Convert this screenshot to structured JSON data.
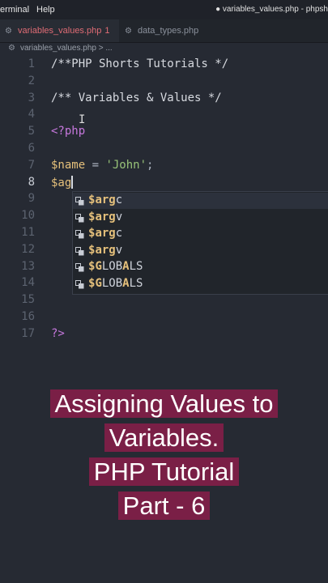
{
  "menubar": {
    "items": [
      "erminal",
      "Help"
    ],
    "title": "● variables_values.php - phpsh"
  },
  "tabs": [
    {
      "label": "variables_values.php",
      "modified": "1",
      "active": true,
      "icon": "php-file-icon"
    },
    {
      "label": "data_types.php",
      "active": false,
      "icon": "php-file-icon"
    }
  ],
  "breadcrumb": "variables_values.php > ...",
  "editor": {
    "lines": [
      {
        "n": "1",
        "parts": [
          {
            "t": "/**PHP Shorts Tutorials */",
            "c": "c-com"
          }
        ]
      },
      {
        "n": "2",
        "parts": []
      },
      {
        "n": "3",
        "parts": [
          {
            "t": "/** Variables & Values */",
            "c": "c-com"
          }
        ]
      },
      {
        "n": "4",
        "parts": []
      },
      {
        "n": "5",
        "parts": [
          {
            "t": "<?php",
            "c": "c-tag"
          }
        ]
      },
      {
        "n": "6",
        "parts": []
      },
      {
        "n": "7",
        "parts": [
          {
            "t": "$name",
            "c": "c-var"
          },
          {
            "t": " = ",
            "c": "c-op"
          },
          {
            "t": "'John'",
            "c": "c-str"
          },
          {
            "t": ";",
            "c": "c-op"
          }
        ]
      },
      {
        "n": "8",
        "parts": [
          {
            "t": "$ag",
            "c": "c-var"
          }
        ],
        "caret": true
      },
      {
        "n": "9",
        "parts": []
      },
      {
        "n": "10",
        "parts": []
      },
      {
        "n": "11",
        "parts": []
      },
      {
        "n": "12",
        "parts": []
      },
      {
        "n": "13",
        "parts": []
      },
      {
        "n": "14",
        "parts": []
      },
      {
        "n": "15",
        "parts": []
      },
      {
        "n": "16",
        "parts": []
      },
      {
        "n": "17",
        "parts": [
          {
            "t": "?>",
            "c": "c-tag"
          }
        ]
      }
    ]
  },
  "suggestions": [
    {
      "pre": "$",
      "match": "arg",
      "post": "c",
      "selected": true
    },
    {
      "pre": "$",
      "match": "arg",
      "post": "v",
      "selected": false
    },
    {
      "pre": "$",
      "match": "arg",
      "post": "c",
      "selected": false
    },
    {
      "pre": "$",
      "match": "arg",
      "post": "v",
      "selected": false
    },
    {
      "pre": "$",
      "match": "G",
      "post": "LOB",
      "match2": "A",
      "post2": "LS",
      "selected": false
    },
    {
      "pre": "$",
      "match": "G",
      "post": "LOB",
      "match2": "A",
      "post2": "LS",
      "selected": false
    }
  ],
  "caption": [
    "Assigning Values to",
    "Variables.",
    "PHP Tutorial",
    "Part - 6"
  ],
  "colors": {
    "caption_bg": "#7a1f46",
    "variable": "#e5c07b",
    "string": "#98c379",
    "tag": "#c678dd"
  }
}
